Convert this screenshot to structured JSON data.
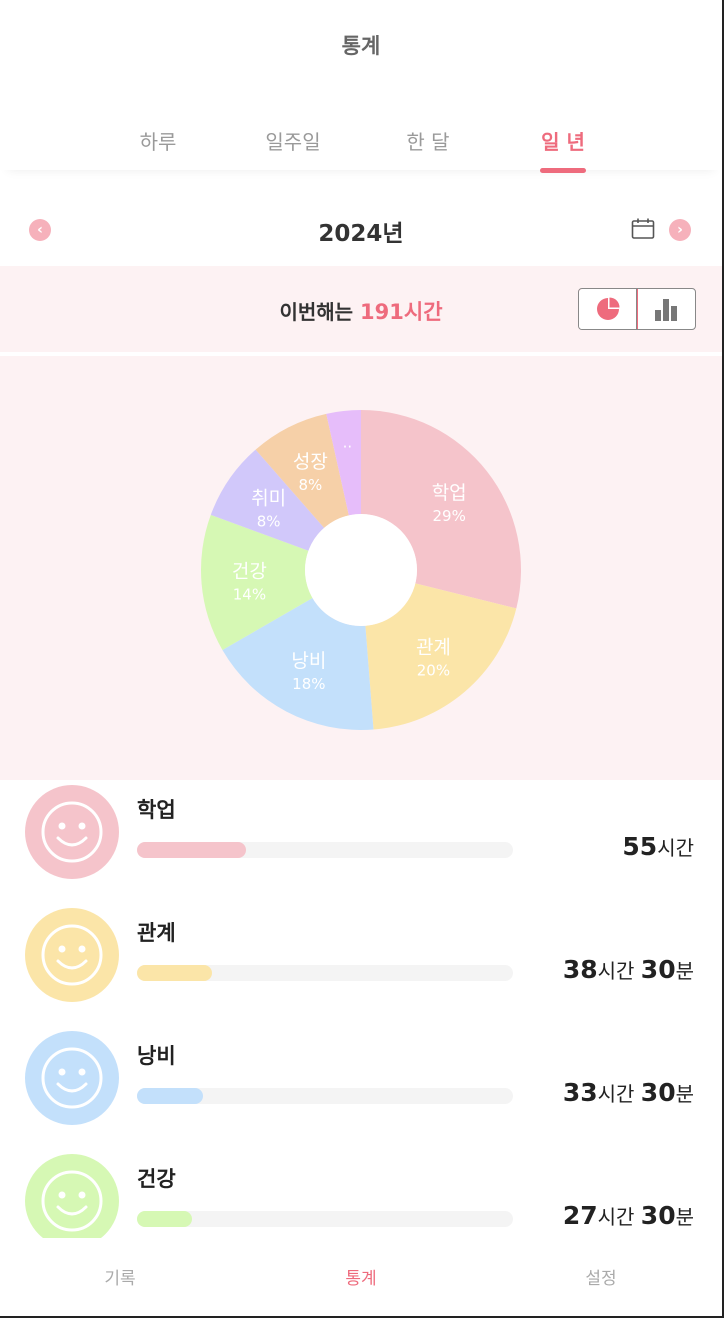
{
  "header": {
    "title": "통계"
  },
  "tabs": [
    {
      "label": "하루",
      "active": false
    },
    {
      "label": "일주일",
      "active": false
    },
    {
      "label": "한 달",
      "active": false
    },
    {
      "label": "일 년",
      "active": true
    }
  ],
  "period": {
    "label": "2024년",
    "prev_icon": "chevron-left-icon",
    "next_icon": "chevron-right-icon",
    "calendar_icon": "calendar-icon"
  },
  "summary": {
    "prefix": "이번해는 ",
    "highlight": "191시간"
  },
  "view_toggle": {
    "pie_icon": "pie-chart-icon",
    "bar_icon": "bar-chart-icon",
    "selected": "pie"
  },
  "chart_data": {
    "type": "pie",
    "donut": true,
    "slices": [
      {
        "label": "학업",
        "percent_label": "29%",
        "value": 29,
        "color": "#f5c4cb"
      },
      {
        "label": "관계",
        "percent_label": "20%",
        "value": 20,
        "color": "#fbe5a8"
      },
      {
        "label": "낭비",
        "percent_label": "18%",
        "value": 18,
        "color": "#c3e0fb"
      },
      {
        "label": "건강",
        "percent_label": "14%",
        "value": 14,
        "color": "#d6f8b4"
      },
      {
        "label": "취미",
        "percent_label": "8%",
        "value": 8,
        "color": "#d1c8fa"
      },
      {
        "label": "성장",
        "percent_label": "8%",
        "value": 8,
        "color": "#f6d0a8"
      },
      {
        "label": "..",
        "percent_label": "",
        "value": 3.5,
        "color": "#e6bdfa"
      }
    ]
  },
  "categories": [
    {
      "name": "학업",
      "color": "#f5c4cb",
      "fill": 0.29,
      "hours": "55",
      "hours_unit": "시간",
      "minutes": "",
      "minutes_unit": ""
    },
    {
      "name": "관계",
      "color": "#fbe5a8",
      "fill": 0.2,
      "hours": "38",
      "hours_unit": "시간",
      "minutes": "30",
      "minutes_unit": "분"
    },
    {
      "name": "낭비",
      "color": "#c3e0fb",
      "fill": 0.175,
      "hours": "33",
      "hours_unit": "시간",
      "minutes": "30",
      "minutes_unit": "분"
    },
    {
      "name": "건강",
      "color": "#d6f8b4",
      "fill": 0.145,
      "hours": "27",
      "hours_unit": "시간",
      "minutes": "30",
      "minutes_unit": "분"
    }
  ],
  "bottom_nav": [
    {
      "label": "기록",
      "active": false
    },
    {
      "label": "통계",
      "active": true
    },
    {
      "label": "설정",
      "active": false
    }
  ]
}
